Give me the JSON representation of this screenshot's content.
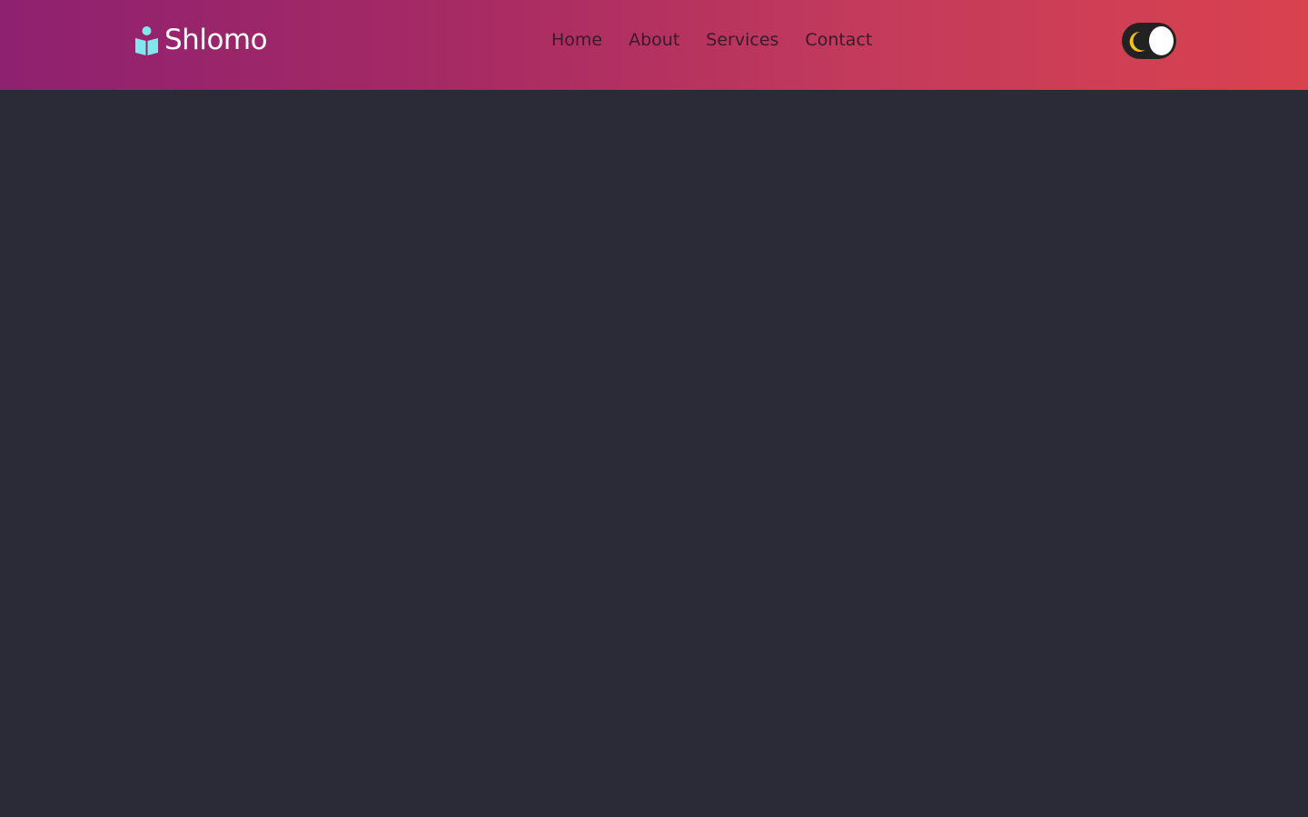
{
  "brand": {
    "name": "Shlomo",
    "icon": "reading-person-icon",
    "icon_color": "#7fe8ec"
  },
  "nav": {
    "items": [
      {
        "label": "Home"
      },
      {
        "label": "About"
      },
      {
        "label": "Services"
      },
      {
        "label": "Contact"
      }
    ]
  },
  "theme_toggle": {
    "icon": "moon-icon",
    "state": "dark",
    "moon_color": "#f2c21b"
  }
}
